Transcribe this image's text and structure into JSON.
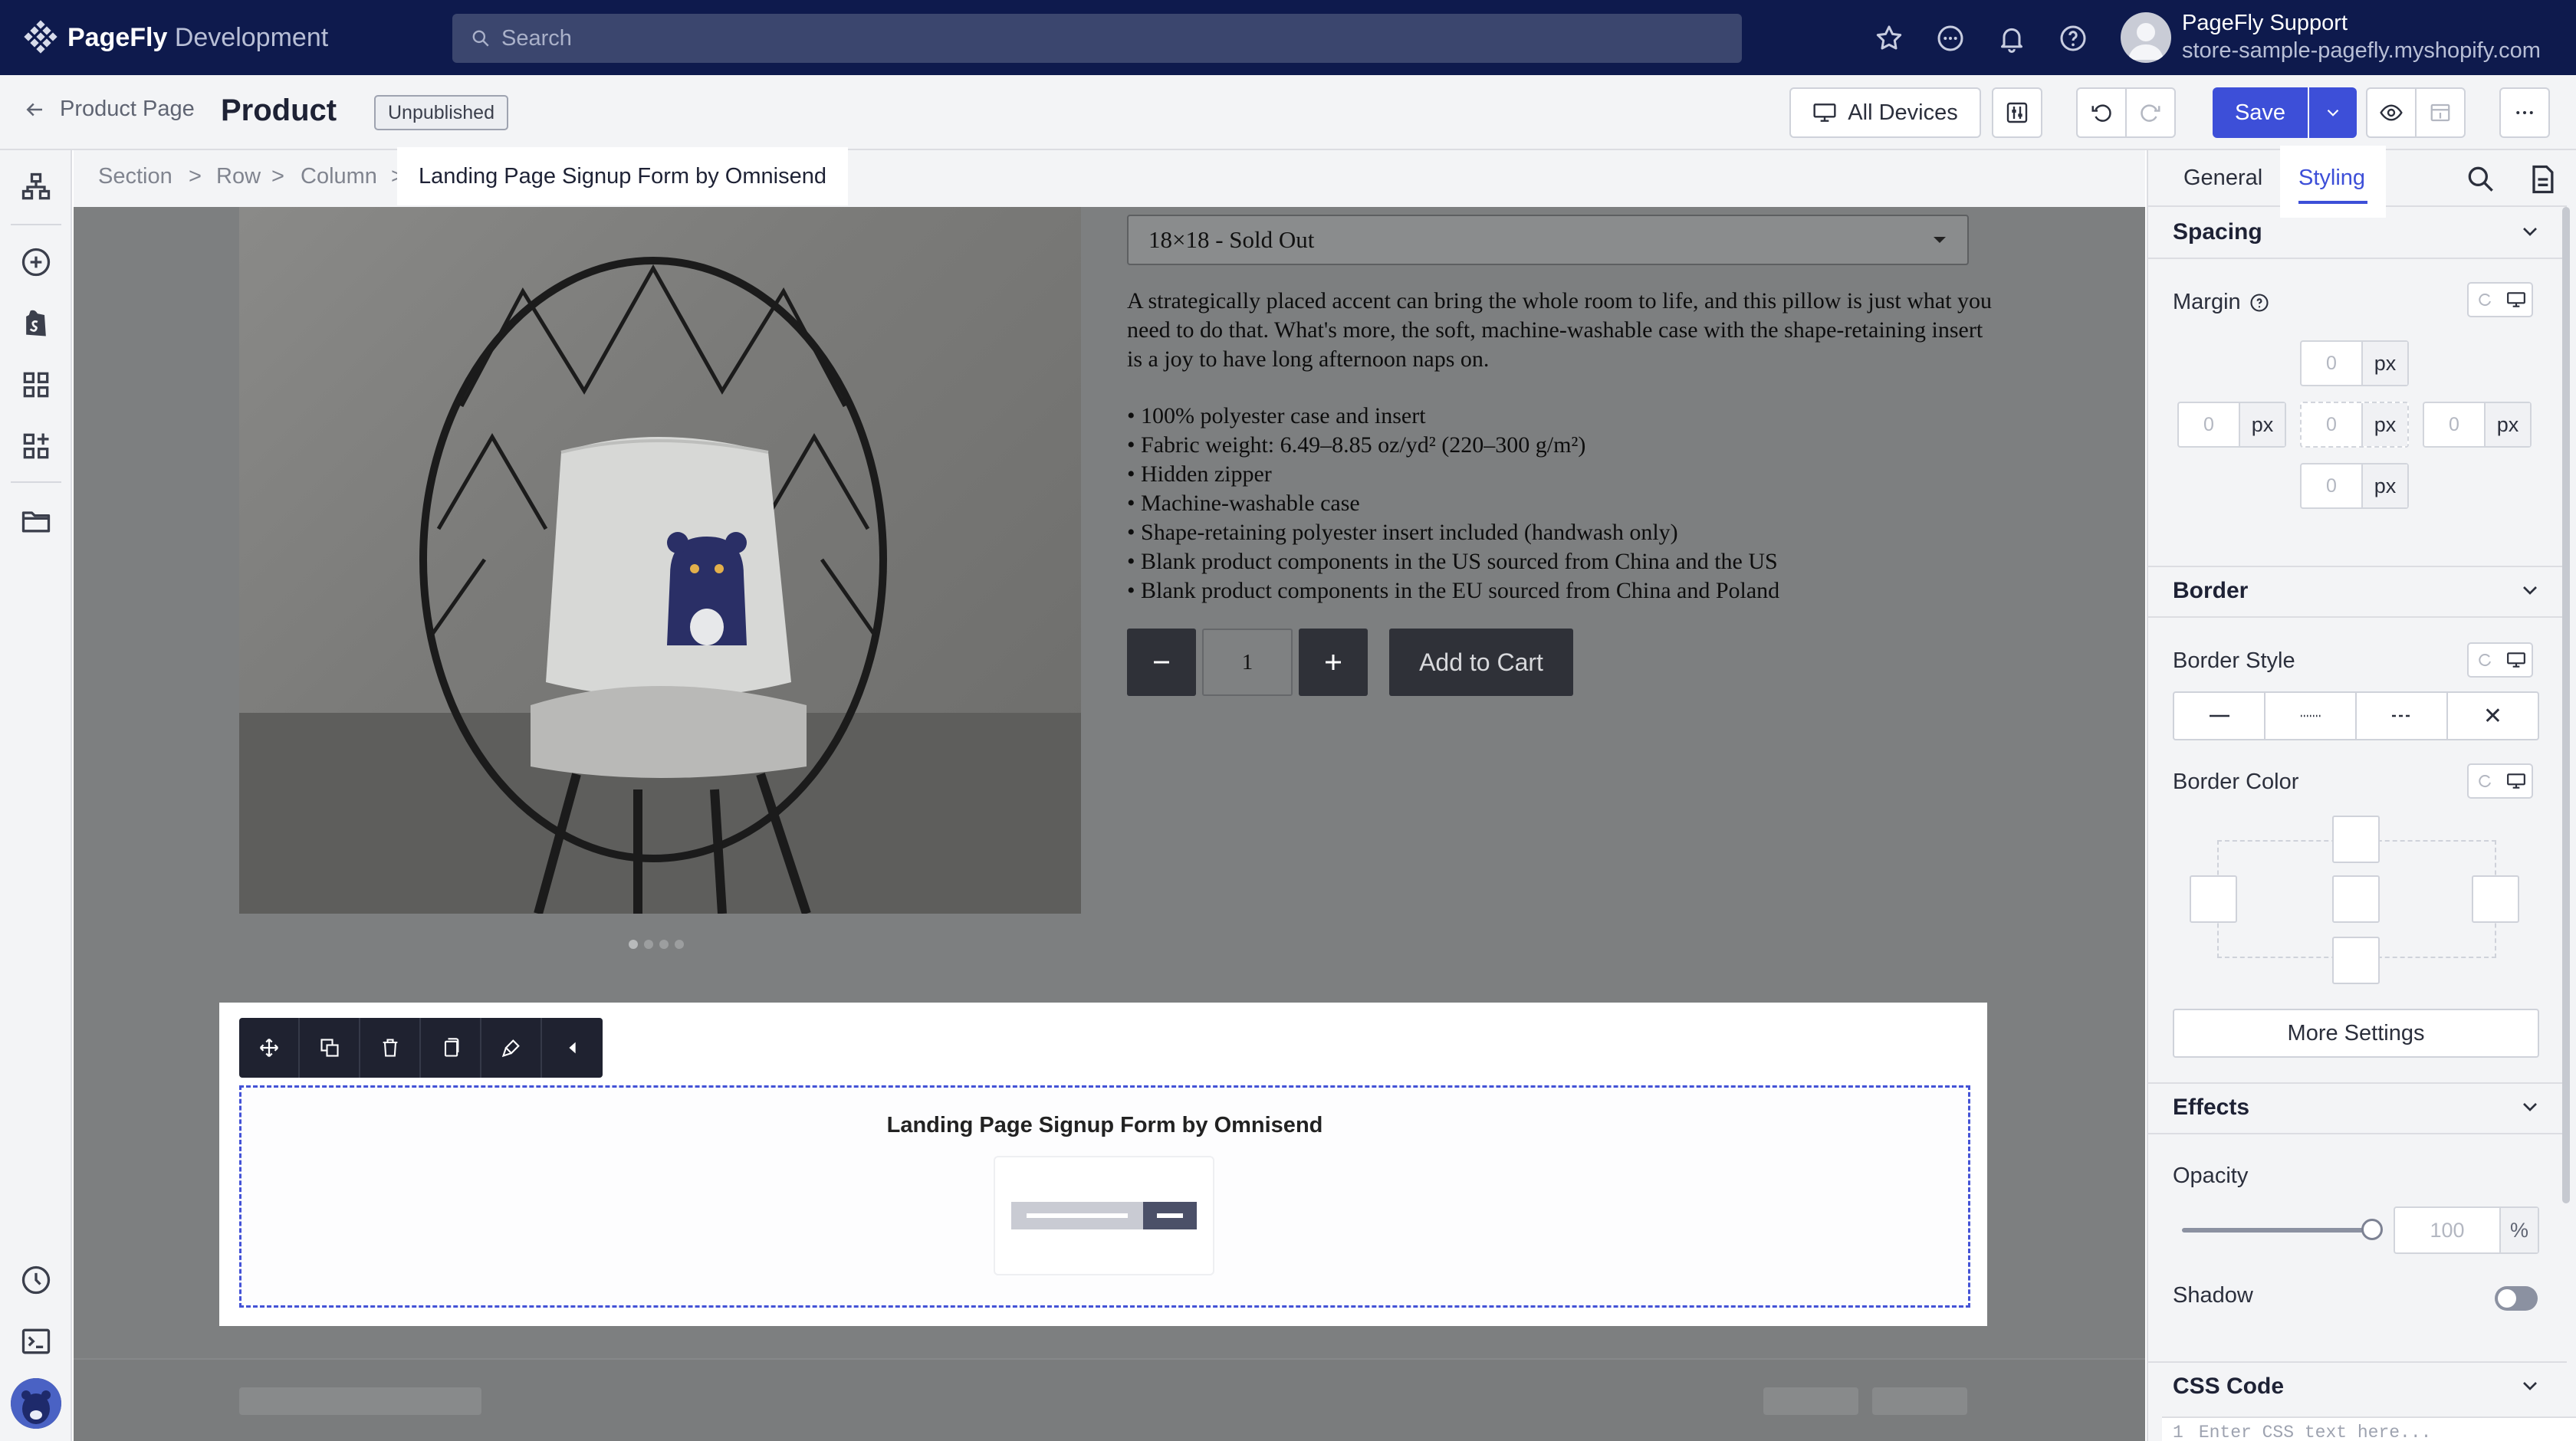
{
  "topbar": {
    "logo_bold": "PageFly",
    "logo_light": " Development",
    "search_placeholder": "Search",
    "user_name": "PageFly Support",
    "store": "store-sample-pagefly.myshopify.com"
  },
  "header": {
    "back_label": "Product Page",
    "title": "Product",
    "status": "Unpublished",
    "devices_label": "All Devices",
    "save_label": "Save"
  },
  "breadcrumb": {
    "items": [
      "Section",
      "Row",
      "Column"
    ],
    "separator": ">",
    "active": "Landing Page Signup Form by Omnisend"
  },
  "product": {
    "variant": "18×18 - Sold Out",
    "description": "A strategically placed accent can bring the whole room to life, and this pillow is just what you need to do that. What's more, the soft, machine-washable case with the shape-retaining insert is a joy to have long afternoon naps on.",
    "bullets": [
      "• 100% polyester case and insert",
      "• Fabric weight: 6.49–8.85 oz/yd² (220–300 g/m²)",
      "• Hidden zipper",
      "• Machine-washable case",
      "• Shape-retaining polyester insert included (handwash only)",
      "• Blank product components in the US sourced from China and the US",
      "• Blank product components in the EU sourced from China and Poland"
    ],
    "quantity": "1",
    "add_to_cart": "Add to Cart"
  },
  "element": {
    "title": "Landing Page Signup Form by Omnisend"
  },
  "panel": {
    "tabs": {
      "general": "General",
      "styling": "Styling"
    },
    "spacing": {
      "title": "Spacing",
      "margin_label": "Margin",
      "values": {
        "top": "0",
        "left": "0",
        "center": "0",
        "right": "0",
        "bottom": "0"
      },
      "unit": "px"
    },
    "border": {
      "title": "Border",
      "style_label": "Border Style",
      "color_label": "Border Color",
      "none_glyph": "✕",
      "more_settings": "More Settings"
    },
    "effects": {
      "title": "Effects",
      "opacity_label": "Opacity",
      "opacity_value": "100",
      "opacity_unit": "%",
      "opacity_level_percent": 100,
      "shadow_label": "Shadow",
      "shadow_on": false
    },
    "css": {
      "title": "CSS Code",
      "line_number": "1",
      "placeholder": "Enter CSS text here..."
    }
  },
  "colors": {
    "topbar": "#0e1a4d",
    "accent": "#3d4fd8",
    "canvas": "#7d7f80"
  }
}
